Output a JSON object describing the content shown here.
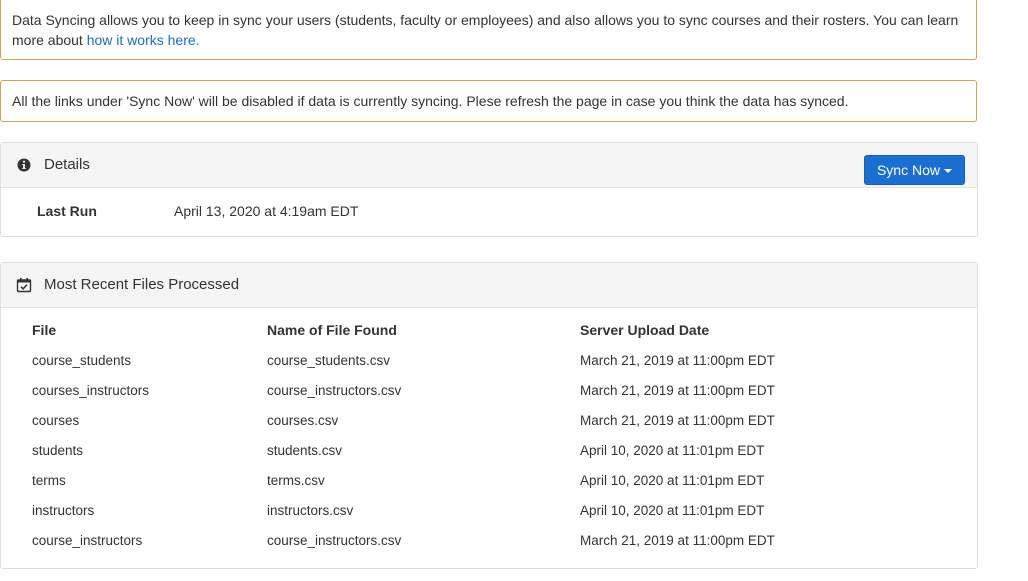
{
  "alerts": {
    "intro_text": "Data Syncing allows you to keep in sync your users (students, faculty or employees) and also allows you to sync courses and their rosters. You can learn more about ",
    "intro_link": "how it works here.",
    "sync_warning": "All the links under 'Sync Now' will be disabled if data is currently syncing. Plese refresh the page in case you think the data has synced."
  },
  "details": {
    "title": "Details",
    "icon": "info-circle-icon",
    "sync_button_label": "Sync Now",
    "last_run_label": "Last Run",
    "last_run_value": "April 13, 2020 at 4:19am EDT"
  },
  "files": {
    "title": "Most Recent Files Processed",
    "icon": "calendar-check-icon",
    "columns": [
      "File",
      "Name of File Found",
      "Server Upload Date"
    ],
    "rows": [
      [
        "course_students",
        "course_students.csv",
        "March 21, 2019 at 11:00pm EDT"
      ],
      [
        "courses_instructors",
        "course_instructors.csv",
        "March 21, 2019 at 11:00pm EDT"
      ],
      [
        "courses",
        "courses.csv",
        "March 21, 2019 at 11:00pm EDT"
      ],
      [
        "students",
        "students.csv",
        "April 10, 2020 at 11:01pm EDT"
      ],
      [
        "terms",
        "terms.csv",
        "April 10, 2020 at 11:01pm EDT"
      ],
      [
        "instructors",
        "instructors.csv",
        "April 10, 2020 at 11:01pm EDT"
      ],
      [
        "course_instructors",
        "course_instructors.csv",
        "March 21, 2019 at 11:00pm EDT"
      ]
    ]
  },
  "colors": {
    "alert_border": "#c9a35a",
    "link": "#1a6fc4",
    "button": "#1a6fd0"
  }
}
